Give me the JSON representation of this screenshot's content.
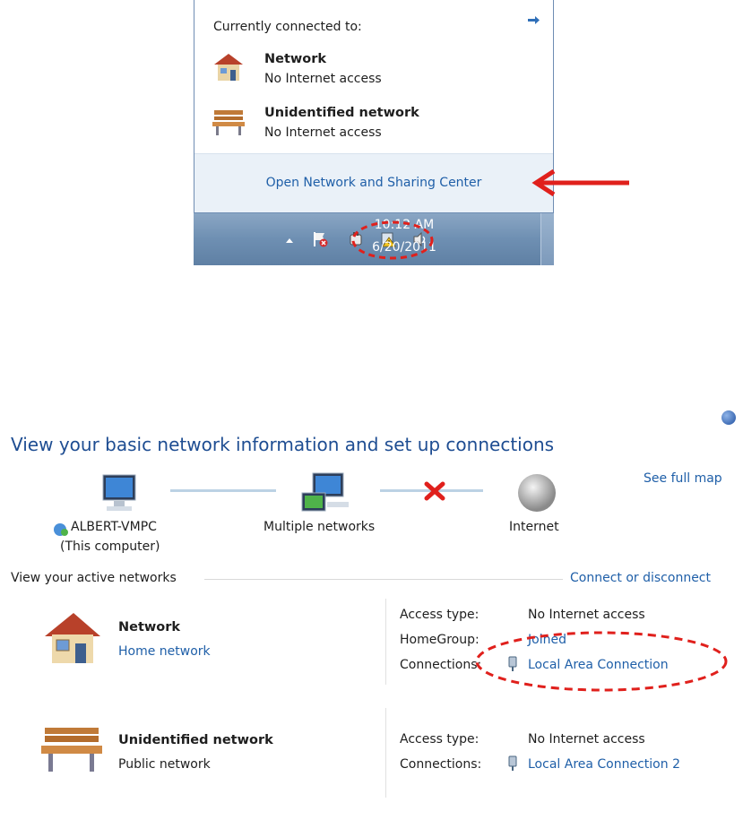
{
  "flyout": {
    "header": "Currently connected to:",
    "networks": [
      {
        "name": "Network",
        "status": "No Internet access",
        "icon": "house-icon"
      },
      {
        "name": "Unidentified network",
        "status": "No Internet access",
        "icon": "bench-icon"
      }
    ],
    "footer_link": "Open Network and Sharing Center"
  },
  "taskbar": {
    "time": "10:12 AM",
    "date": "6/20/2011",
    "tray_icons": [
      "show-hidden-icons-arrow",
      "action-center-flag-icon",
      "power-icon",
      "network-warning-icon",
      "volume-icon"
    ]
  },
  "sharing_center": {
    "title": "View your basic network information and set up connections",
    "see_full_map": "See full map",
    "map": {
      "computer_name": "ALBERT-VMPC",
      "computer_sub": "(This computer)",
      "middle": "Multiple networks",
      "internet": "Internet"
    },
    "active_networks_label": "View your active networks",
    "connect_disconnect": "Connect or disconnect",
    "active": [
      {
        "name": "Network",
        "type": "Home network",
        "type_is_link": true,
        "access_label": "Access type:",
        "access_value": "No Internet access",
        "homegroup_label": "HomeGroup:",
        "homegroup_value": "Joined",
        "connections_label": "Connections:",
        "connection": "Local Area Connection"
      },
      {
        "name": "Unidentified network",
        "type": "Public network",
        "type_is_link": false,
        "access_label": "Access type:",
        "access_value": "No Internet access",
        "connections_label": "Connections:",
        "connection": "Local Area Connection 2"
      }
    ]
  },
  "colors": {
    "link": "#1f5fa8",
    "title": "#1e4d92",
    "annotation_red": "#e0201c",
    "flyout_footer_bg": "#eaf1f8"
  }
}
